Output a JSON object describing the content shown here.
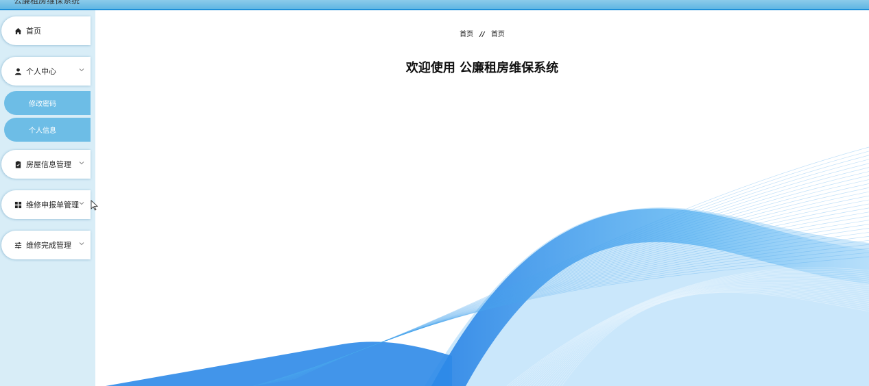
{
  "header": {
    "title": "公廉租房维保系统"
  },
  "sidebar": {
    "home": {
      "label": "首页",
      "icon": "home-icon"
    },
    "personal": {
      "label": "个人中心",
      "icon": "user-icon"
    },
    "personal_sub": [
      {
        "label": "修改密码"
      },
      {
        "label": "个人信息"
      }
    ],
    "house": {
      "label": "房屋信息管理",
      "icon": "clipboard-icon"
    },
    "repair_report": {
      "label": "维修申报单管理",
      "icon": "grid-icon"
    },
    "repair_done": {
      "label": "维修完成管理",
      "icon": "sliders-icon"
    }
  },
  "breadcrumb": {
    "first": "首页",
    "separator": "//",
    "second": "首页"
  },
  "main": {
    "welcome": "欢迎使用 公廉租房维保系统"
  },
  "colors": {
    "sidebar_bg": "#d8edf7",
    "submenu_bg": "#6dbde6",
    "topbar": "#5ab3e2",
    "wave": "#1e8fe8"
  }
}
